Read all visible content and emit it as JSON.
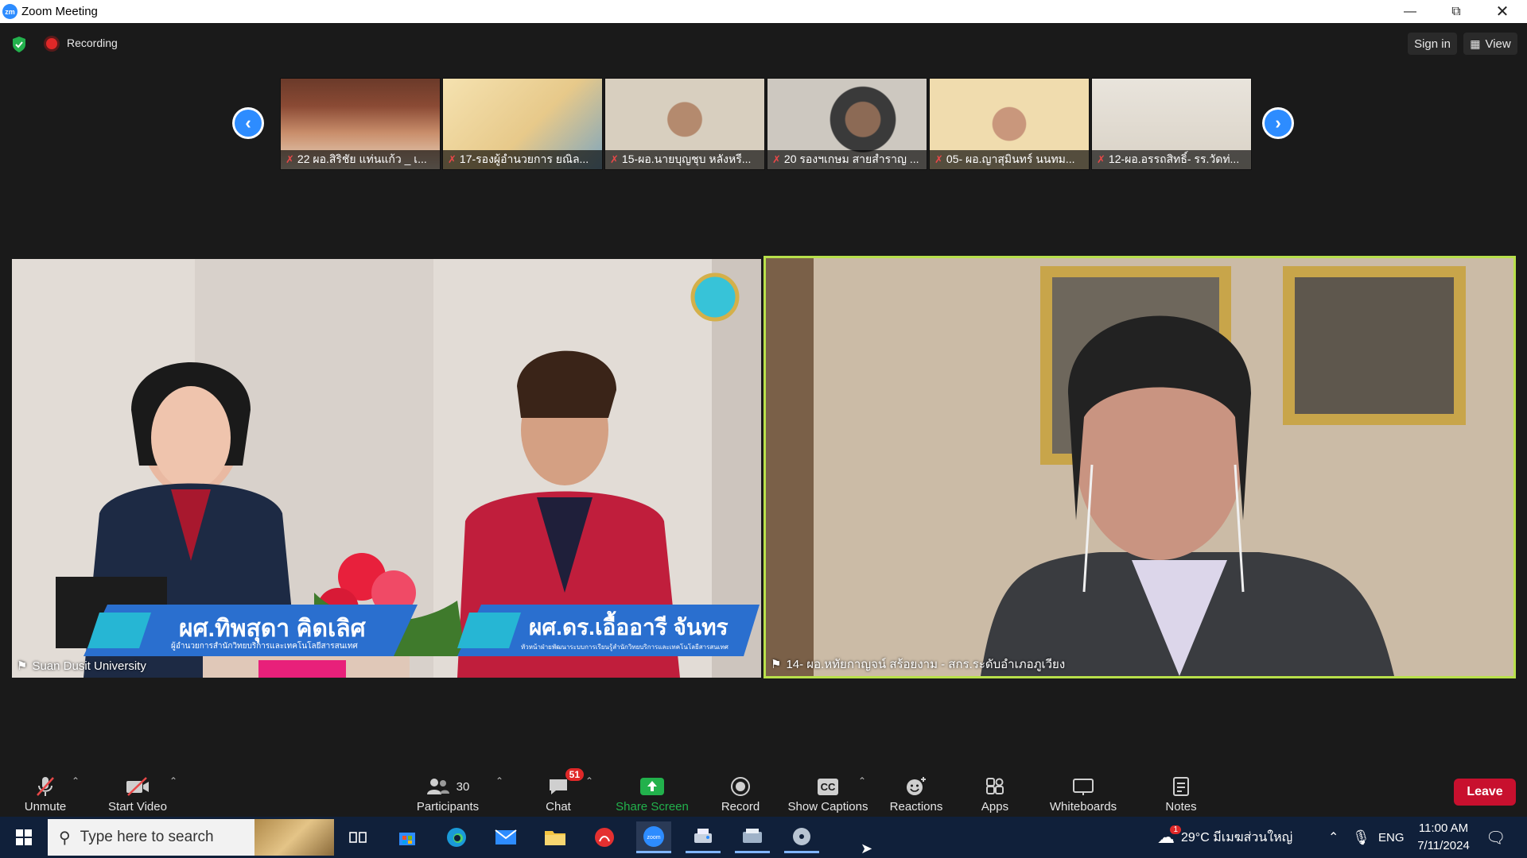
{
  "window": {
    "title": "Zoom Meeting",
    "logo_text": "zm"
  },
  "topbar": {
    "recording_label": "Recording",
    "signin_label": "Sign in",
    "view_label": "View"
  },
  "thumbnails": [
    {
      "name": "22 ผอ.สิริชัย แท่นแก้ว _ เ..."
    },
    {
      "name": "17-รองผู้อำนวยการ ยณิล..."
    },
    {
      "name": "15-ผอ.นายบุญชุบ หลังหรี..."
    },
    {
      "name": "20 รองฯเกษม สายสำราญ ..."
    },
    {
      "name": "05- ผอ.ญาสุมินทร์ นนทม..."
    },
    {
      "name": "12-ผอ.อรรถสิทธิ์- รร.วัดท่..."
    }
  ],
  "main_left": {
    "participant": "Suan Dusit University",
    "name_plate_1": "ผศ.ทิพสุดา คิดเลิศ",
    "name_plate_1_sub": "ผู้อำนวยการสำนักวิทยบริการและเทคโนโลยีสารสนเทศ",
    "name_plate_2": "ผศ.ดร.เอื้ออารี จันทร",
    "name_plate_2_sub": "หัวหน้าฝ่ายพัฒนาระบบการเรียนรู้สำนักวิทยบริการและเทคโนโลยีสารสนเทศ"
  },
  "main_right": {
    "participant": "14- ผอ.หทัยกาญจน์ สร้อยงาม - สกร.ระดับอำเภอภูเวียง"
  },
  "toolbar": {
    "unmute": "Unmute",
    "start_video": "Start Video",
    "participants": "Participants",
    "participants_count": "30",
    "chat": "Chat",
    "chat_badge": "51",
    "share_screen": "Share Screen",
    "record": "Record",
    "show_captions": "Show Captions",
    "captions_icon": "CC",
    "reactions": "Reactions",
    "apps": "Apps",
    "whiteboards": "Whiteboards",
    "notes": "Notes",
    "leave": "Leave"
  },
  "taskbar": {
    "search_placeholder": "Type here to search",
    "weather": "29°C มีเมฆส่วนใหญ่",
    "weather_badge": "1",
    "language": "ENG",
    "time": "11:00 AM",
    "date": "7/11/2024"
  },
  "colors": {
    "accent": "#2d8cff",
    "leave": "#c8102e",
    "share": "#22b14c",
    "speaker_border": "#b8e04a"
  }
}
